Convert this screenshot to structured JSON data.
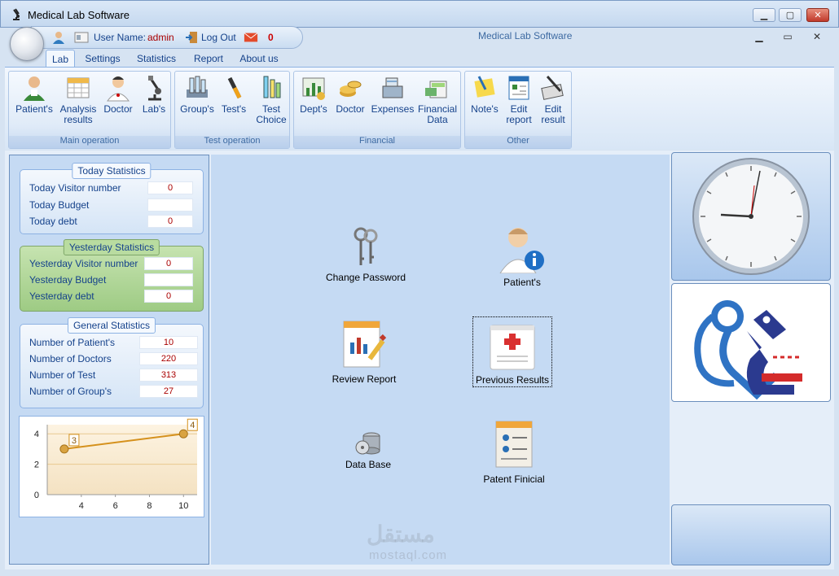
{
  "window": {
    "title": "Medical Lab Software"
  },
  "qat": {
    "user_label": "User Name:",
    "user_value": "admin",
    "logout": "Log Out",
    "message_count": "0"
  },
  "ribbon_title": "Medical Lab Software",
  "tabs": [
    "Lab",
    "Settings",
    "Statistics",
    "Report",
    "About us"
  ],
  "groups": {
    "main": {
      "label": "Main operation",
      "items": [
        "Patient's",
        "Analysis results",
        "Doctor",
        "Lab's"
      ]
    },
    "test": {
      "label": "Test operation",
      "items": [
        "Group's",
        "Test's",
        "Test Choice"
      ]
    },
    "financial": {
      "label": "Financial",
      "items": [
        "Dept's",
        "Doctor",
        "Expenses",
        "Financial Data"
      ]
    },
    "other": {
      "label": "Other",
      "items": [
        "Note's",
        "Edit report",
        "Edit result"
      ]
    }
  },
  "today": {
    "title": "Today Statistics",
    "rows": [
      {
        "label": "Today Visitor number",
        "value": "0"
      },
      {
        "label": "Today Budget",
        "value": ""
      },
      {
        "label": "Today debt",
        "value": "0"
      }
    ]
  },
  "yesterday": {
    "title": "Yesterday Statistics",
    "rows": [
      {
        "label": "Yesterday Visitor number",
        "value": "0"
      },
      {
        "label": "Yesterday Budget",
        "value": ""
      },
      {
        "label": "Yesterday debt",
        "value": "0"
      }
    ]
  },
  "general": {
    "title": "General Statistics",
    "rows": [
      {
        "label": "Number of Patient's",
        "value": "10"
      },
      {
        "label": "Number of Doctors",
        "value": "220"
      },
      {
        "label": "Number of Test",
        "value": "313"
      },
      {
        "label": "Number of Group's",
        "value": "27"
      }
    ]
  },
  "chart_data": {
    "type": "line",
    "x": [
      3,
      10
    ],
    "y": [
      3,
      4
    ],
    "data_labels": [
      "3",
      "4"
    ],
    "xticks": [
      "4",
      "6",
      "8",
      "10"
    ],
    "yticks": [
      "0",
      "2",
      "4"
    ],
    "xlim": [
      2,
      10.8
    ],
    "ylim": [
      0,
      4.6
    ],
    "grid": true
  },
  "center": [
    {
      "label": "Change Password",
      "icon": "keys-icon"
    },
    {
      "label": "Patient's",
      "icon": "patient-info-icon"
    },
    {
      "label": "Review Report",
      "icon": "report-chart-icon"
    },
    {
      "label": "Previous Results",
      "icon": "medical-clipboard-icon"
    },
    {
      "label": "Data Base",
      "icon": "database-icon"
    },
    {
      "label": "Patent Finicial",
      "icon": "patient-document-icon"
    }
  ],
  "colors": {
    "accent": "#15428b",
    "value_red": "#aa0000",
    "green_box": "#9ecb84"
  }
}
